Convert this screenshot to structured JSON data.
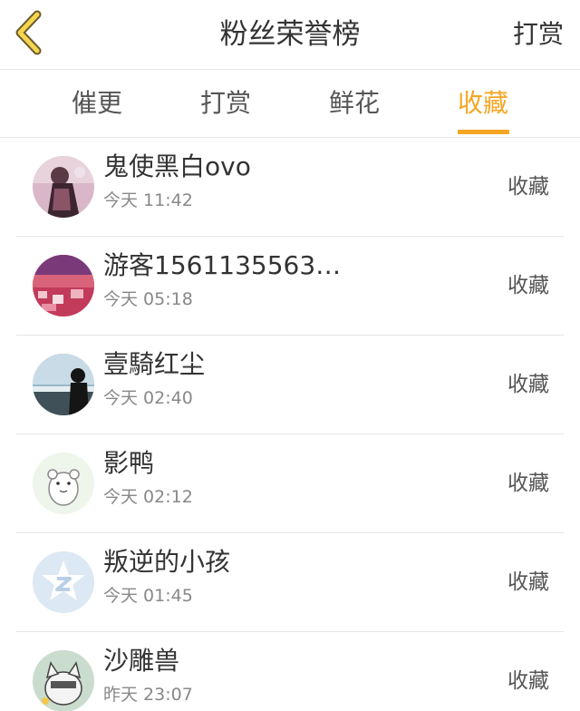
{
  "header": {
    "title": "粉丝荣誉榜",
    "action_label": "打赏",
    "back_icon": "chevron-left-icon",
    "accent_color": "#f5a623"
  },
  "tabs": [
    {
      "label": "催更",
      "active": false
    },
    {
      "label": "打赏",
      "active": false
    },
    {
      "label": "鲜花",
      "active": false
    },
    {
      "label": "收藏",
      "active": true
    }
  ],
  "list": [
    {
      "name": "鬼使黑白ovo",
      "time": "今天 11:42",
      "action": "收藏"
    },
    {
      "name": "游客1561135563…",
      "time": "今天 05:18",
      "action": "收藏"
    },
    {
      "name": "壹騎红尘",
      "time": "今天 02:40",
      "action": "收藏"
    },
    {
      "name": "影鸭",
      "time": "今天 02:12",
      "action": "收藏"
    },
    {
      "name": "叛逆的小孩",
      "time": "今天 01:45",
      "action": "收藏"
    },
    {
      "name": "沙雕兽",
      "time": "昨天 23:07",
      "action": "收藏"
    }
  ]
}
